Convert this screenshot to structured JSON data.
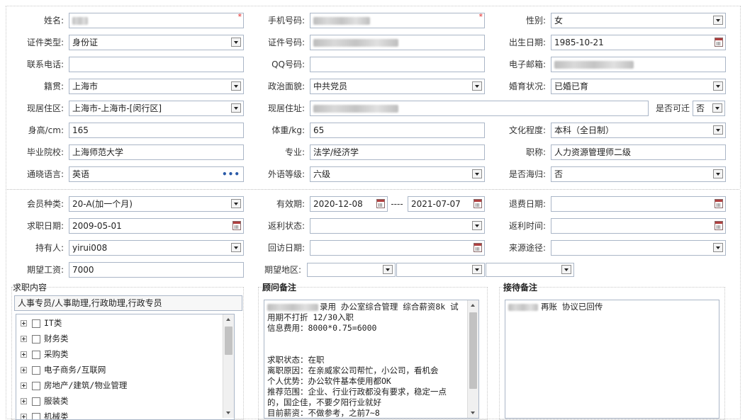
{
  "personal": {
    "name": {
      "label": "姓名:"
    },
    "mobile": {
      "label": "手机号码:"
    },
    "gender": {
      "label": "性别:",
      "value": "女"
    },
    "id_type": {
      "label": "证件类型:",
      "value": "身份证"
    },
    "id_number": {
      "label": "证件号码:"
    },
    "birth_date": {
      "label": "出生日期:",
      "value": "1985-10-21"
    },
    "phone": {
      "label": "联系电话:",
      "value": ""
    },
    "qq": {
      "label": "QQ号码:",
      "value": ""
    },
    "email": {
      "label": "电子邮箱:"
    },
    "native_place": {
      "label": "籍贯:",
      "value": "上海市"
    },
    "political": {
      "label": "政治面貌:",
      "value": "中共党员"
    },
    "marital": {
      "label": "婚育状况:",
      "value": "已婚已育"
    },
    "residence_area": {
      "label": "现居住区:",
      "value": "上海市-上海市-[闵行区]"
    },
    "residence_address": {
      "label": "现居住址:"
    },
    "relocatable": {
      "label": "是否可迁",
      "value": "否"
    },
    "height": {
      "label": "身高/cm:",
      "value": "165"
    },
    "weight": {
      "label": "体重/kg:",
      "value": "65"
    },
    "education": {
      "label": "文化程度:",
      "value": "本科（全日制）"
    },
    "school": {
      "label": "毕业院校:",
      "value": "上海师范大学"
    },
    "major": {
      "label": "专业:",
      "value": "法学/经济学"
    },
    "title": {
      "label": "职称:",
      "value": "人力资源管理师二级"
    },
    "language": {
      "label": "通晓语言:",
      "value": "英语",
      "more": "•••"
    },
    "language_level": {
      "label": "外语等级:",
      "value": "六级"
    },
    "returnee": {
      "label": "是否海归:",
      "value": "否"
    }
  },
  "membership": {
    "type": {
      "label": "会员种类:",
      "value": "20-A(加一个月)"
    },
    "validity": {
      "label": "有效期:",
      "start": "2020-12-08",
      "sep": "----",
      "end": "2021-07-07"
    },
    "refund_date": {
      "label": "退费日期:",
      "value": ""
    },
    "job_date": {
      "label": "求职日期:",
      "value": "2009-05-01"
    },
    "rebate_status": {
      "label": "返利状态:",
      "value": ""
    },
    "rebate_time": {
      "label": "返利时间:",
      "value": ""
    },
    "holder": {
      "label": "持有人:",
      "value": "yirui008"
    },
    "visit_date": {
      "label": "回访日期:",
      "value": ""
    },
    "source": {
      "label": "来源途径:",
      "value": ""
    },
    "salary": {
      "label": "期望工资:",
      "value": "7000"
    },
    "region": {
      "label": "期望地区:",
      "values": [
        "",
        "",
        ""
      ]
    }
  },
  "job": {
    "title": "求职内容",
    "summary": "人事专员/人事助理,行政助理,行政专员",
    "categories": [
      "IT类",
      "财务类",
      "采购类",
      "电子商务/互联网",
      "房地产/建筑/物业管理",
      "服装类",
      "机械类"
    ]
  },
  "consultant": {
    "title": "顾问备注",
    "lines": [
      "录用 办公室综合管理 综合薪资8k 试",
      "用期不打折 12/30入职",
      "信息费用：8000*0.75=6000",
      "",
      "",
      "求职状态：在职",
      "离职原因：在亲威家公司帮忙，小公司，看机会",
      "个人优势：办公软件基本使用都OK",
      "推荐范围：企业、行业行政都没有要求，稳定一点",
      "的，国企佳，不要夕阳行业就好",
      "目前薪资：不做参考，之前7~8"
    ]
  },
  "reception": {
    "title": "接待备注",
    "note": "再账 协议已回传"
  },
  "colors": {
    "border": "#aab6c7",
    "required": "#e02020",
    "scroll_thumb": "#c2c2c2"
  }
}
